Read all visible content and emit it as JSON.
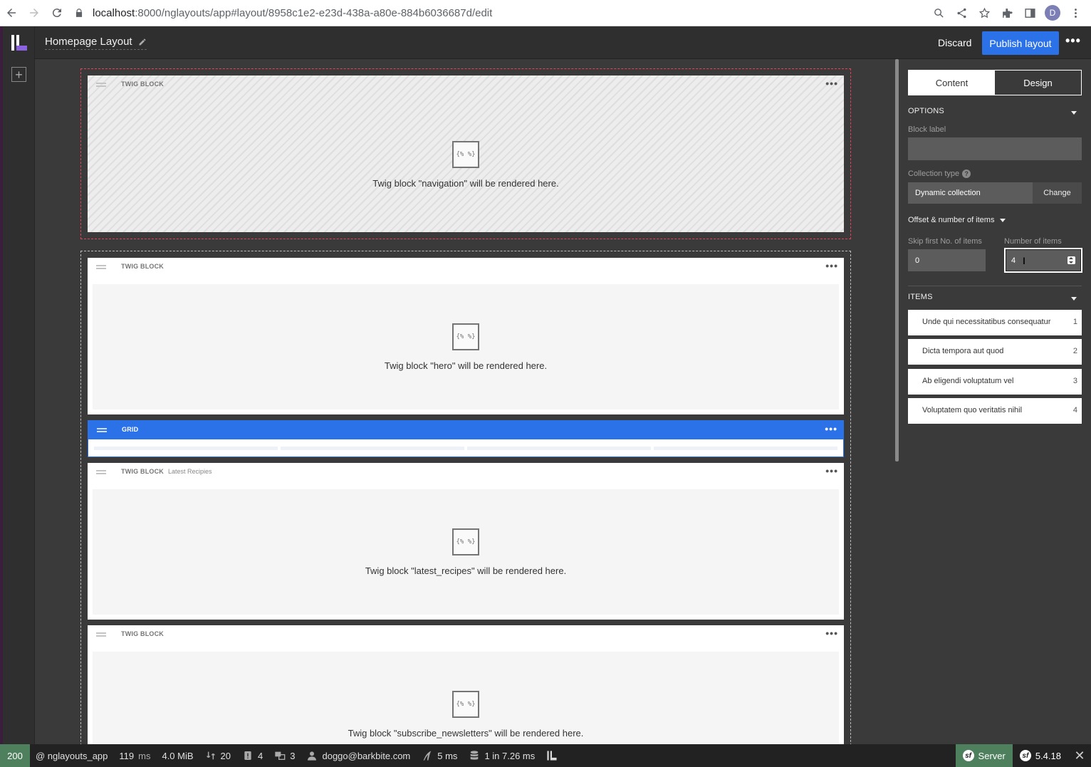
{
  "browser": {
    "url_host": "localhost",
    "url_rest": ":8000/nglayouts/app#layout/8958c1e2-e23d-438a-a80e-884b6036687d/edit",
    "profile_initial": "D"
  },
  "header": {
    "title": "Homepage Layout",
    "discard_label": "Discard",
    "publish_label": "Publish layout",
    "more_label": "•••"
  },
  "canvas": {
    "blocks": [
      {
        "type": "TWIG BLOCK",
        "label": "",
        "icon_text": "{% %}",
        "text": "Twig block \"navigation\" will be rendered here."
      },
      {
        "type": "TWIG BLOCK",
        "label": "",
        "icon_text": "{% %}",
        "text": "Twig block \"hero\" will be rendered here."
      },
      {
        "type": "GRID",
        "label": ""
      },
      {
        "type": "TWIG BLOCK",
        "label": "Latest Recipies",
        "icon_text": "{% %}",
        "text": "Twig block \"latest_recipes\" will be rendered here."
      },
      {
        "type": "TWIG BLOCK",
        "label": "",
        "icon_text": "{% %}",
        "text": "Twig block \"subscribe_newsletters\" will be rendered here."
      }
    ],
    "more_label": "•••"
  },
  "panel": {
    "tabs": {
      "content": "Content",
      "design": "Design"
    },
    "options_title": "OPTIONS",
    "block_label": "Block label",
    "block_label_value": "",
    "collection_type_label": "Collection type",
    "collection_type_help": "?",
    "collection_type_value": "Dynamic collection",
    "change_label": "Change",
    "offset_toggle": "Offset & number of items",
    "skip_label": "Skip first No. of items",
    "skip_value": "0",
    "number_label": "Number of items",
    "number_value": "4",
    "items_title": "ITEMS",
    "items": [
      {
        "text": "Unde qui necessitatibus consequatur",
        "num": "1"
      },
      {
        "text": "Dicta tempora aut quod",
        "num": "2"
      },
      {
        "text": "Ab eligendi voluptatum vel",
        "num": "3"
      },
      {
        "text": "Voluptatem quo veritatis nihil",
        "num": "4"
      }
    ]
  },
  "sf_toolbar": {
    "status": "200",
    "route": "@ nglayouts_app",
    "time": "119",
    "time_unit": "ms",
    "memory": "4.0 MiB",
    "requests": "20",
    "logs": "4",
    "translations": "3",
    "user": "doggo@barkbite.com",
    "twig_time": "5 ms",
    "db": "1 in 7.26 ms",
    "server_label": "Server",
    "version": "5.4.18",
    "close_label": "✕",
    "status_color": "#4f805d"
  },
  "colors": {
    "accent": "#2b72e8",
    "selected_zone": "#e2435a"
  }
}
